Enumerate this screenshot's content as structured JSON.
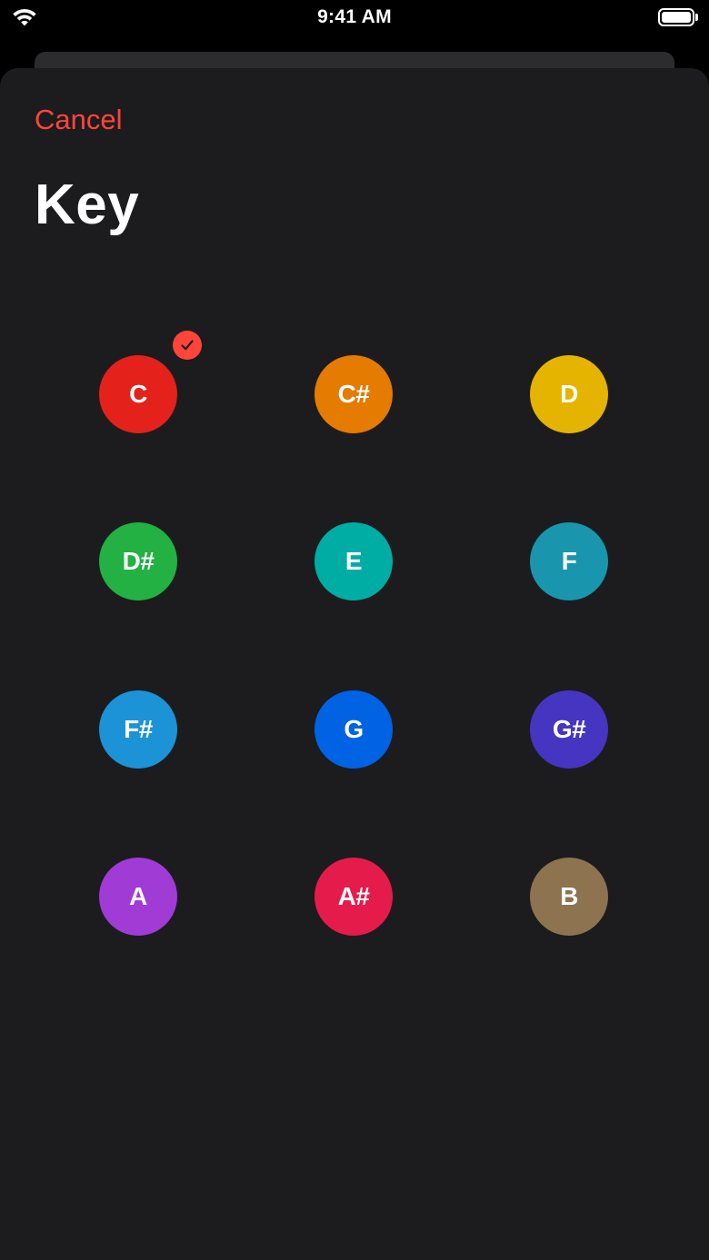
{
  "status_bar": {
    "time": "9:41 AM",
    "wifi_icon": "wifi-icon",
    "battery_icon": "battery-icon",
    "battery_level": 1.0
  },
  "nav": {
    "cancel_label": "Cancel",
    "title": "Key"
  },
  "accent_color": "#ff453a",
  "selected_key": "C",
  "check_icon": "checkmark-icon",
  "keys": [
    {
      "label": "C",
      "color": "#e5211b",
      "selected": true
    },
    {
      "label": "C#",
      "color": "#e57b00",
      "selected": false
    },
    {
      "label": "D",
      "color": "#e5b400",
      "selected": false
    },
    {
      "label": "D#",
      "color": "#22b142",
      "selected": false
    },
    {
      "label": "E",
      "color": "#00ada4",
      "selected": false
    },
    {
      "label": "F",
      "color": "#1996ad",
      "selected": false
    },
    {
      "label": "F#",
      "color": "#1b93d6",
      "selected": false
    },
    {
      "label": "G",
      "color": "#0063e3",
      "selected": false
    },
    {
      "label": "G#",
      "color": "#4535c0",
      "selected": false
    },
    {
      "label": "A",
      "color": "#a13bd6",
      "selected": false
    },
    {
      "label": "A#",
      "color": "#e51c4b",
      "selected": false
    },
    {
      "label": "B",
      "color": "#8d7350",
      "selected": false
    }
  ]
}
